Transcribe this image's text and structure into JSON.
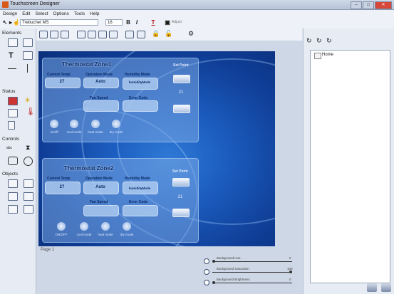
{
  "window": {
    "title": "Touchscreen Designer"
  },
  "menu": [
    "Design",
    "Edit",
    "Select",
    "Options",
    "Tools",
    "Help"
  ],
  "toolbar": {
    "font": "Trebuchet MS",
    "size": "16",
    "bold": "B",
    "italic": "I",
    "align_label": "Adjust"
  },
  "left_panel": {
    "elements": "Elements",
    "status": "Status",
    "controls": "Controls",
    "objects": "Objects"
  },
  "zones": [
    {
      "title": "Thermostat Zone1",
      "current_temp_label": "Current Temp",
      "current_temp": "27",
      "operation_mode_label": "Operation Mode",
      "operation_mode": "Auto",
      "humidity_mode_label": "Humidity Mode",
      "humidity_mode": "humidityMode",
      "fan_speed_label": "Fan Speed",
      "error_code_label": "Error Code",
      "setpoint_label": "Set Point",
      "setpoint": "21",
      "modes": [
        "on/off",
        "cool mode",
        "heat mode",
        "dry mode"
      ]
    },
    {
      "title": "Thermostat Zone2",
      "current_temp_label": "Current Temp",
      "current_temp": "27",
      "operation_mode_label": "Operation Mode",
      "operation_mode": "Auto",
      "humidity_mode_label": "Humidity Mode",
      "humidity_mode": "humidityMode",
      "fan_speed_label": "Fan Speed",
      "error_code_label": "Error Code",
      "setpoint_label": "Set Point",
      "setpoint": "21",
      "modes": [
        "ON/OFF",
        "cool mode",
        "heat mode",
        "dry mode"
      ]
    }
  ],
  "page_label": "Page 1",
  "sliders": [
    {
      "label": "Background Hue",
      "value": "0",
      "level": 0.0
    },
    {
      "label": "Background Saturation",
      "value": "100",
      "level": 1.0
    },
    {
      "label": "Background Brightness",
      "value": "0",
      "level": 0.0
    }
  ],
  "tree": {
    "root": "Home"
  },
  "colors": {
    "canvas": "#1c5ec0",
    "zone": "#78a5e1",
    "titlebar": "#cfd8e6"
  }
}
